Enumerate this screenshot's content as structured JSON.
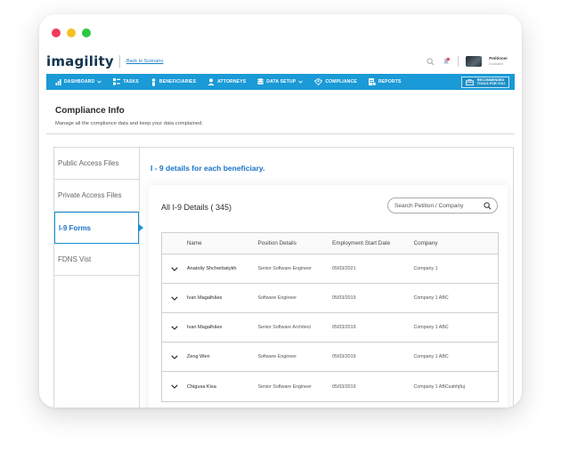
{
  "app": {
    "logo_main": "imagility",
    "back_link": "Back to Scenario",
    "user_name": "Petitioner",
    "user_status": "Available"
  },
  "nav": {
    "items": [
      {
        "label": "DASHBOARD",
        "icon": "bar-chart-icon",
        "dropdown": true
      },
      {
        "label": "TASKS",
        "icon": "tasks-icon",
        "dropdown": false
      },
      {
        "label": "BENEFICIARIES",
        "icon": "person-icon",
        "dropdown": false
      },
      {
        "label": "ATTORNEYS",
        "icon": "attorney-icon",
        "dropdown": false
      },
      {
        "label": "DATA SETUP",
        "icon": "database-icon",
        "dropdown": true
      },
      {
        "label": "COMPLIANCE",
        "icon": "compliance-icon",
        "dropdown": false
      },
      {
        "label": "REPORTS",
        "icon": "reports-icon",
        "dropdown": false
      }
    ],
    "recommended_line1": "RECOMMENDED",
    "recommended_line2": "TOOLS FOR YOU"
  },
  "page": {
    "title": "Compliance Info",
    "subtitle": "Manage all the compliance data and keep your data complained."
  },
  "sidebar": {
    "items": [
      {
        "label": "Public Access Files",
        "active": false
      },
      {
        "label": "Private Access Files",
        "active": false
      },
      {
        "label": "I-9 Forms",
        "active": true
      },
      {
        "label": "FDNS Vist",
        "active": false
      }
    ]
  },
  "main": {
    "title": "I - 9 details for each beneficiary.",
    "panel_title": "All I-9 Details ( 345)",
    "search_placeholder": "Search Petition / Company"
  },
  "table": {
    "headers": [
      "Name",
      "Position Details",
      "Employment Start Date",
      "Company"
    ],
    "rows": [
      [
        "Anatoliy Shcherbatykh",
        "Senior Software Engineer",
        "05/03/2021",
        "Company 1"
      ],
      [
        "Ivan Magalhães",
        "Software Engineer",
        "05/03/2019",
        "Company 1 ABC"
      ],
      [
        "Ivan Magalhães",
        "Senior Software Architect",
        "05/03/2019",
        "Company 1 ABC"
      ],
      [
        "Zeng Wen",
        "Software Engineer",
        "05/03/2019",
        "Company 1 ABC"
      ],
      [
        "Chigusa Kisa",
        "Senior Software Engineer",
        "05/03/2019",
        "Company 1 ABCsahhjfuj"
      ]
    ]
  },
  "colors": {
    "nav_blue": "#1a9ad6",
    "accent_blue": "#1a73c8",
    "logo_dark": "#14344e",
    "logo_accent": "#17a8e6"
  }
}
